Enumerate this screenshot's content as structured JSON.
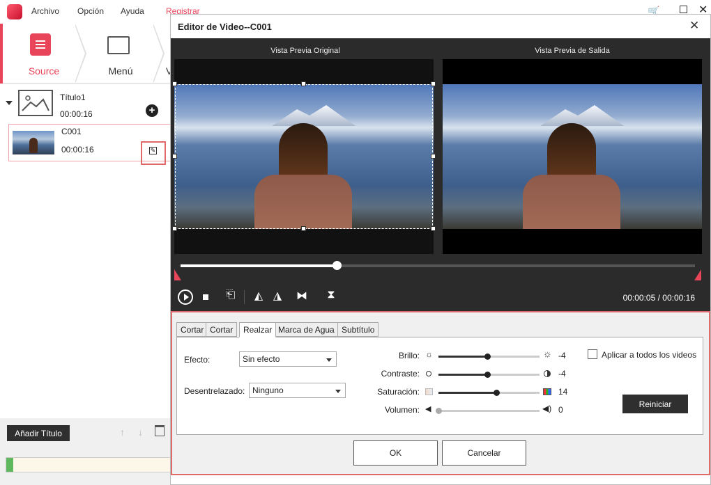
{
  "app": {
    "menu": [
      "Archivo",
      "Opción",
      "Ayuda",
      "Registrar"
    ],
    "steps": [
      {
        "label": "Source",
        "icon": "file-icon"
      },
      {
        "label": "Menú",
        "icon": "image-menu-icon"
      },
      {
        "label": "V",
        "icon": "next-step"
      }
    ]
  },
  "left": {
    "title_item": {
      "name": "Título1",
      "duration": "00:00:16"
    },
    "clip_item": {
      "name": "C001",
      "duration": "00:00:16"
    },
    "add_title_label": "Añadir Título",
    "colors": {
      "accent": "#e8455a"
    }
  },
  "dialog": {
    "title": "Editor de Video--C001",
    "preview_original_label": "Vista Previa Original",
    "preview_output_label": "Vista Previa de Salida",
    "playback_progress": 0.303,
    "time_display": "00:00:05 / 00:00:16",
    "tabs": [
      "Cortar",
      "Cortar",
      "Realzar",
      "Marca de Agua",
      "Subtítulo"
    ],
    "active_tab": "Realzar",
    "effect_label": "Efecto:",
    "effect_value": "Sin efecto",
    "deinterlace_label": "Desentrelazado:",
    "deinterlace_value": "Ninguno",
    "sliders": [
      {
        "label": "Brillo:",
        "value": "-4",
        "level": 0.48
      },
      {
        "label": "Contraste:",
        "value": "-4",
        "level": 0.48
      },
      {
        "label": "Saturación:",
        "value": "14",
        "level": 0.57
      },
      {
        "label": "Volumen:",
        "value": "0",
        "level": 0.0
      }
    ],
    "apply_all_label": "Aplicar a todos los videos",
    "reset_label": "Reiniciar",
    "ok_label": "OK",
    "cancel_label": "Cancelar"
  }
}
